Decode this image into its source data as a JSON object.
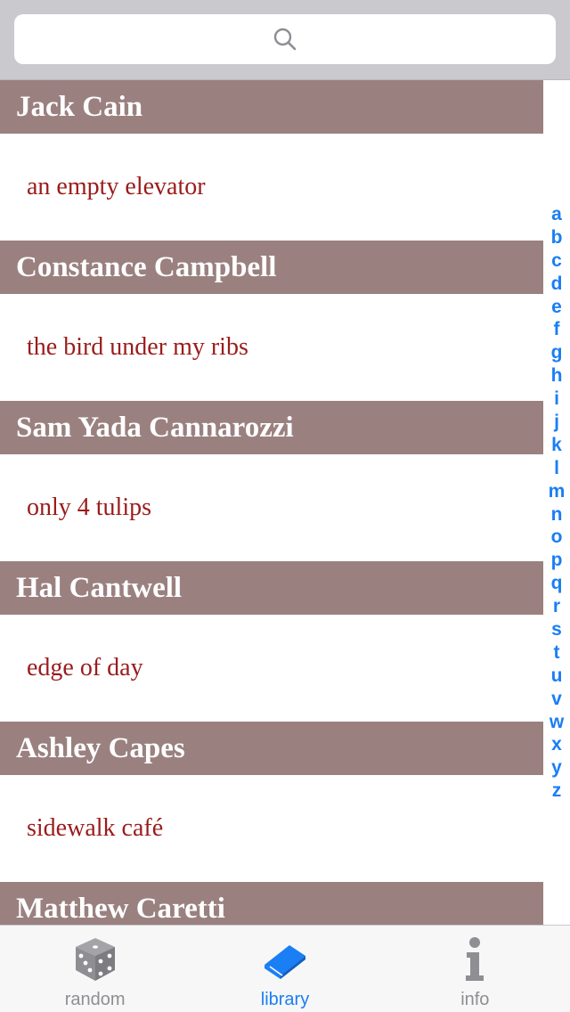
{
  "search": {
    "placeholder": ""
  },
  "sections": [
    {
      "author": "Jack Cain",
      "title": "an empty elevator"
    },
    {
      "author": "Constance Campbell",
      "title": "the bird under my ribs"
    },
    {
      "author": "Sam Yada Cannarozzi",
      "title": "only 4 tulips"
    },
    {
      "author": "Hal Cantwell",
      "title": "edge of day"
    },
    {
      "author": "Ashley Capes",
      "title": "sidewalk café"
    },
    {
      "author": "Matthew Caretti",
      "title": ""
    }
  ],
  "index_letters": [
    "a",
    "b",
    "c",
    "d",
    "e",
    "f",
    "g",
    "h",
    "i",
    "j",
    "k",
    "l",
    "m",
    "n",
    "o",
    "p",
    "q",
    "r",
    "s",
    "t",
    "u",
    "v",
    "w",
    "x",
    "y",
    "z"
  ],
  "tabs": [
    {
      "label": "random",
      "icon": "dice-icon",
      "active": false
    },
    {
      "label": "library",
      "icon": "book-icon",
      "active": true
    },
    {
      "label": "info",
      "icon": "info-icon",
      "active": false
    }
  ],
  "colors": {
    "section_header_bg": "#9a8180",
    "row_text": "#9b1b1b",
    "accent": "#1a7ef5",
    "inactive_tab": "#8e8e93"
  }
}
